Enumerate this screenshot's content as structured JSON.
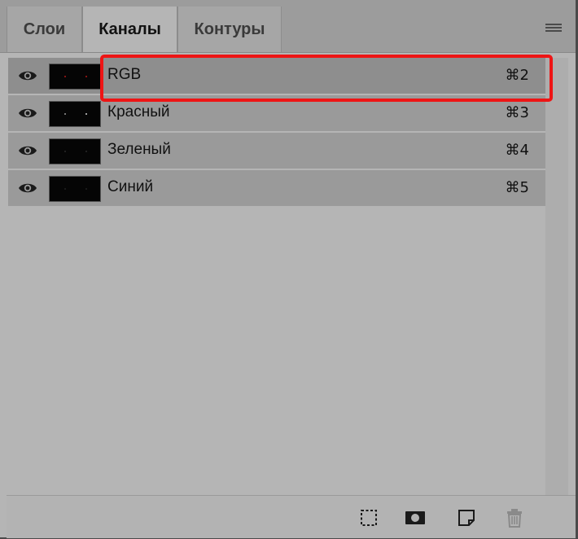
{
  "tabs": [
    {
      "label": "Слои"
    },
    {
      "label": "Каналы"
    },
    {
      "label": "Контуры"
    }
  ],
  "channels": [
    {
      "name": "RGB",
      "shortcut": "⌘2"
    },
    {
      "name": "Красный",
      "shortcut": "⌘3"
    },
    {
      "name": "Зеленый",
      "shortcut": "⌘4"
    },
    {
      "name": "Синий",
      "shortcut": "⌘5"
    }
  ],
  "colors": {
    "highlight": "#ee1515",
    "panel": "#b5b5b5"
  },
  "footer_icons": [
    "selection-icon",
    "mask-icon",
    "new-channel-icon",
    "trash-icon"
  ]
}
